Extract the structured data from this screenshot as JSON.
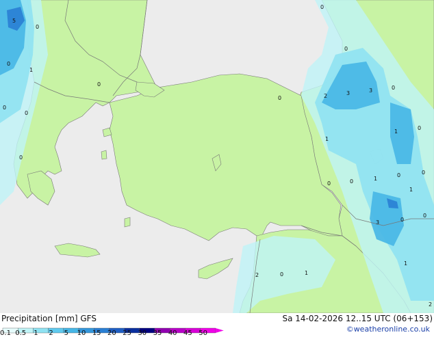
{
  "map": {
    "colors": {
      "sea": "#ececec",
      "land": "#c8f3a4",
      "border": "#777777",
      "precip_light": "#bff4f7",
      "precip_mid": "#8fe2f2",
      "precip_heavy": "#46b6e6",
      "precip_max": "#2a7fd4"
    },
    "contour_labels": [
      {
        "id": "w1",
        "text": "5"
      },
      {
        "id": "w2",
        "text": "0"
      },
      {
        "id": "w3",
        "text": "0"
      },
      {
        "id": "w4",
        "text": "1"
      },
      {
        "id": "w5",
        "text": "0"
      },
      {
        "id": "w6",
        "text": "0"
      },
      {
        "id": "w7",
        "text": "0"
      },
      {
        "id": "w8",
        "text": "0"
      },
      {
        "id": "w9",
        "text": "0"
      },
      {
        "id": "e1",
        "text": "0"
      },
      {
        "id": "e2",
        "text": "0"
      },
      {
        "id": "e3",
        "text": "2"
      },
      {
        "id": "e4",
        "text": "3"
      },
      {
        "id": "e5",
        "text": "3"
      },
      {
        "id": "e6",
        "text": "0"
      },
      {
        "id": "e7",
        "text": "0"
      },
      {
        "id": "e8",
        "text": "1"
      },
      {
        "id": "e9",
        "text": "1"
      },
      {
        "id": "e10",
        "text": "0"
      },
      {
        "id": "e11",
        "text": "0"
      },
      {
        "id": "e12",
        "text": "1"
      },
      {
        "id": "e13",
        "text": "0"
      },
      {
        "id": "e14",
        "text": "0"
      },
      {
        "id": "e15",
        "text": "3"
      },
      {
        "id": "e16",
        "text": "0"
      },
      {
        "id": "e17",
        "text": "1"
      },
      {
        "id": "e18",
        "text": "2"
      },
      {
        "id": "s1",
        "text": "2"
      },
      {
        "id": "s2",
        "text": "0"
      },
      {
        "id": "s3",
        "text": "1"
      },
      {
        "id": "e19",
        "text": "0"
      },
      {
        "id": "e20",
        "text": "1"
      }
    ]
  },
  "footer": {
    "title": "Precipitation [mm] GFS",
    "timestamp": "Sa 14-02-2026 12..15 UTC (06+153)",
    "credit": "©weatheronline.co.uk",
    "legend": {
      "labels": [
        "0.1",
        "0.5",
        "1",
        "2",
        "5",
        "10",
        "15",
        "20",
        "25",
        "30",
        "35",
        "40",
        "45",
        "50"
      ],
      "colors": [
        "#e6fcfc",
        "#bff4f7",
        "#8fe2f2",
        "#5fcaee",
        "#46b6e6",
        "#3497dc",
        "#2a7fd4",
        "#1f5fc4",
        "#0a2f9e",
        "#000080",
        "#9000b0",
        "#b800c8",
        "#d800d8",
        "#f000e8"
      ]
    }
  }
}
